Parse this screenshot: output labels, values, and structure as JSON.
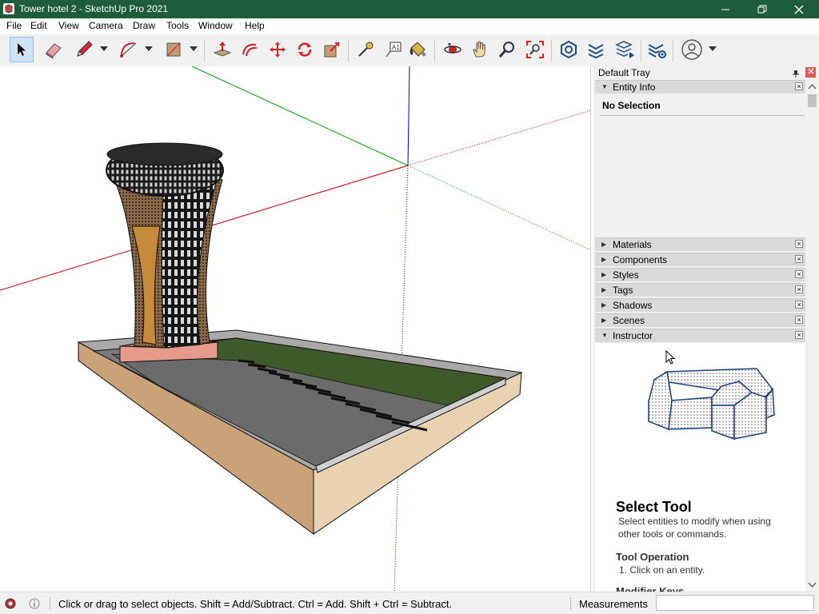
{
  "window": {
    "title": "Tower hotel 2 - SketchUp Pro 2021"
  },
  "menu": [
    "File",
    "Edit",
    "View",
    "Camera",
    "Draw",
    "Tools",
    "Window",
    "Help"
  ],
  "toolbar": {
    "tools": [
      "select-tool",
      "eraser-tool",
      "line-tool",
      "arc-tool",
      "rectangle-tool",
      "push-pull-tool",
      "offset-tool",
      "move-tool",
      "rotate-tool",
      "scale-tool",
      "tape-measure-tool",
      "text-tool",
      "paint-bucket-tool",
      "orbit-tool",
      "pan-tool",
      "zoom-tool",
      "zoom-extents-tool",
      "warehouse-tool",
      "extension-tool",
      "layout-tool",
      "extension-manager-tool",
      "account-tool"
    ],
    "active": "select-tool"
  },
  "tray": {
    "title": "Default Tray",
    "entity_info": {
      "label": "Entity Info",
      "selection": "No Selection",
      "expanded": true
    },
    "panels": [
      {
        "label": "Materials",
        "expanded": false
      },
      {
        "label": "Components",
        "expanded": false
      },
      {
        "label": "Styles",
        "expanded": false
      },
      {
        "label": "Tags",
        "expanded": false
      },
      {
        "label": "Shadows",
        "expanded": false
      },
      {
        "label": "Scenes",
        "expanded": false
      },
      {
        "label": "Instructor",
        "expanded": true
      }
    ],
    "instructor": {
      "title": "Select Tool",
      "description": "Select entities to modify when using other tools or commands.",
      "operation_heading": "Tool Operation",
      "step": "1. Click on an entity.",
      "modifier_heading": "Modifier Keys"
    }
  },
  "status": {
    "text": "Click or drag to select objects. Shift = Add/Subtract. Ctrl = Add. Shift + Ctrl = Subtract.",
    "measurements_label": "Measurements",
    "measurements_value": ""
  },
  "colors": {
    "titlebar": "#1d5d3c",
    "axis_red": "#cc0000",
    "axis_green": "#009900",
    "axis_blue": "#0000cc",
    "lawn": "#3f5a2a",
    "tower_accent": "#c68a3a"
  }
}
